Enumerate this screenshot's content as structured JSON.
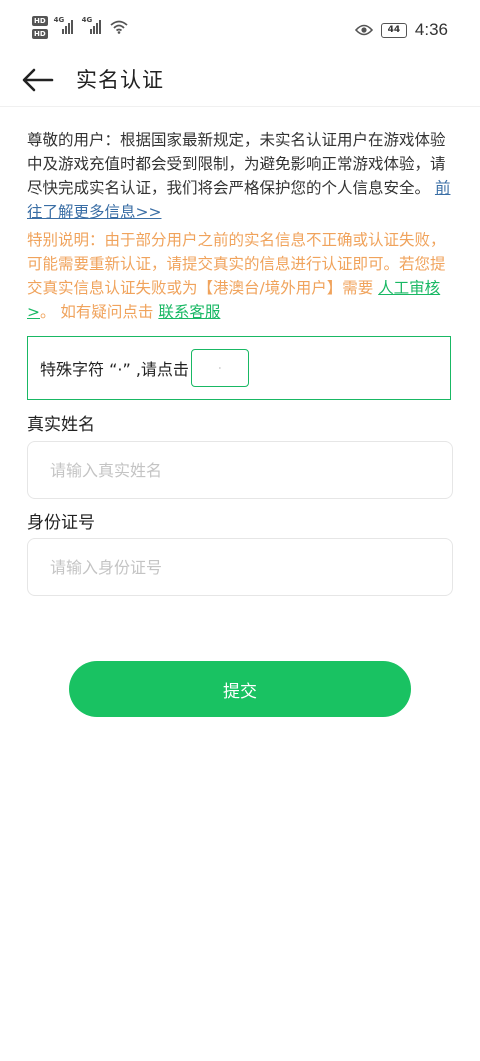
{
  "status_bar": {
    "hd_1": "HD",
    "hd_2": "HD",
    "signal_1_label": "4G",
    "signal_2_label": "4G",
    "battery": "44",
    "time": "4:36"
  },
  "header": {
    "title": "实名认证"
  },
  "notice": {
    "main_text": "尊敬的用户：根据国家最新规定，未实名认证用户在游戏体验中及游戏充值时都会受到限制，为避免影响正常游戏体验，请尽快完成实名认证，我们将会严格保护您的个人信息安全。",
    "more_link": "前往了解更多信息>>",
    "special_text": "特别说明：由于部分用户之前的实名信息不正确或认证失败，可能需要重新认证，请提交真实的信息进行认证即可。若您提交真实信息认证失败或为【港澳台/境外用户】需要 ",
    "manual_link": "人工审核>",
    "question_text": "。 如有疑问点击 ",
    "service_link": "联系客服"
  },
  "captcha": {
    "prompt": "特殊字符 “·” ,请点击",
    "button_glyph": "·"
  },
  "form": {
    "name_label": "真实姓名",
    "name_placeholder": "请输入真实姓名",
    "id_label": "身份证号",
    "id_placeholder": "请输入身份证号",
    "submit_label": "提交"
  }
}
